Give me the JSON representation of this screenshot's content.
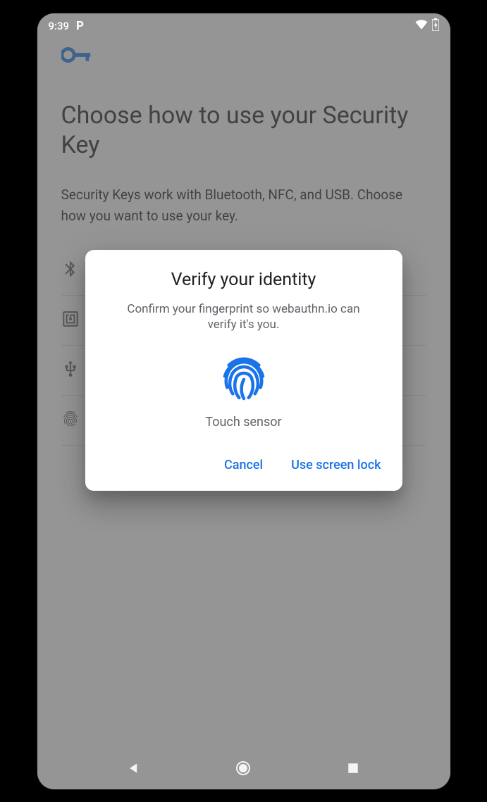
{
  "statusbar": {
    "time": "9:39"
  },
  "page": {
    "title": "Choose how to use your Security Key",
    "subtitle": "Security Keys work with Bluetooth, NFC, and USB. Choose how you want to use your key.",
    "options": [
      {
        "icon": "bluetooth",
        "label": ""
      },
      {
        "icon": "nfc",
        "label": ""
      },
      {
        "icon": "usb",
        "label": ""
      },
      {
        "icon": "fingerprint",
        "label": ""
      }
    ]
  },
  "dialog": {
    "title": "Verify your identity",
    "message": "Confirm your fingerprint so webauthn.io can verify it's you.",
    "sensor_hint": "Touch sensor",
    "cancel": "Cancel",
    "screen_lock": "Use screen lock"
  }
}
